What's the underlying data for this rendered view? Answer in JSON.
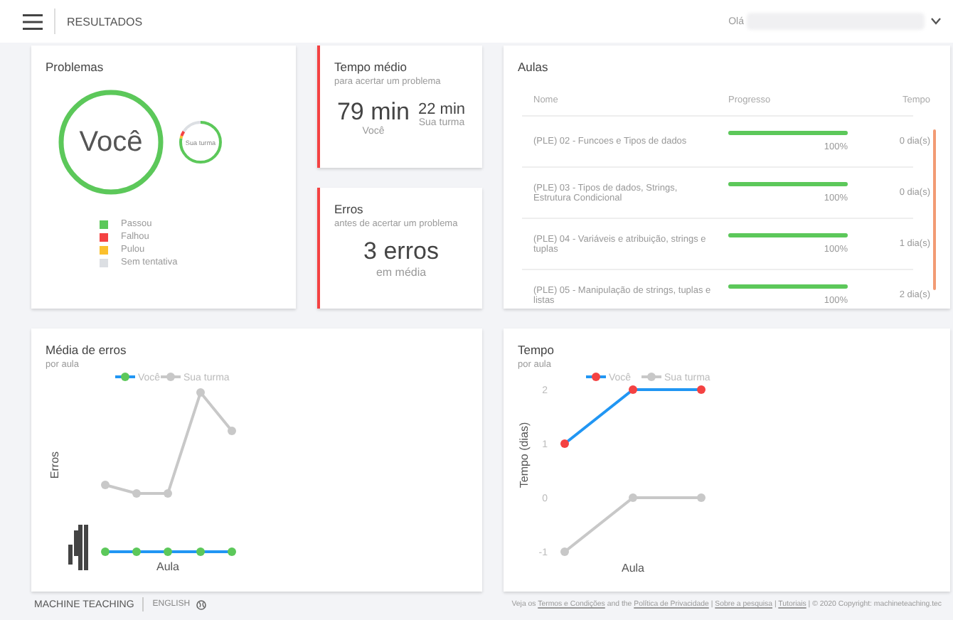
{
  "header": {
    "title": "RESULTADOS",
    "greeting": "Olá"
  },
  "problemas": {
    "title": "Problemas",
    "you_label": "Você",
    "class_label": "Sua turma",
    "legend": [
      {
        "label": "Passou",
        "color": "#5cc85a"
      },
      {
        "label": "Falhou",
        "color": "#f44242"
      },
      {
        "label": "Pulou",
        "color": "#fbc02d"
      },
      {
        "label": "Sem tentativa",
        "color": "#dcdfe3"
      }
    ]
  },
  "tempo_medio": {
    "title": "Tempo médio",
    "subtitle": "para acertar um problema",
    "you_value": "79 min",
    "you_label": "Você",
    "class_value": "22 min",
    "class_label": "Sua turma"
  },
  "erros": {
    "title": "Erros",
    "subtitle": "antes de acertar um problema",
    "value": "3 erros",
    "caption": "em média"
  },
  "aulas": {
    "title": "Aulas",
    "columns": [
      "Nome",
      "Progresso",
      "Tempo"
    ],
    "rows": [
      {
        "name": "(PLE) 02 - Funcoes e Tipos de dados",
        "level": 1,
        "progress": "100%",
        "time": "0 dia(s)"
      },
      {
        "name": "(PLE) 03 - Tipos de dados, Strings, Estrutura Condicional",
        "level": 1,
        "progress": "100%",
        "time": "0 dia(s)"
      },
      {
        "name": "(PLE) 04 - Variáveis e atribuição, strings e tuplas",
        "level": 1,
        "progress": "100%",
        "time": "1 dia(s)"
      },
      {
        "name": "(PLE) 05 - Manipulação de strings, tuplas e listas",
        "level": 1,
        "progress": "100%",
        "time": "2 dia(s)"
      }
    ]
  },
  "media_erros": {
    "title": "Média de erros",
    "subtitle": "por aula",
    "legend": [
      "Você",
      "Sua turma"
    ],
    "ylabel": "Erros",
    "xlabel": "Aula"
  },
  "tempo": {
    "title": "Tempo",
    "subtitle": "por aula",
    "chart_data": {
      "type": "line",
      "xlabel": "Aula",
      "ylabel": "Tempo (dias)",
      "yticks": [
        -1,
        0,
        1,
        2
      ],
      "ylim": [
        -1,
        2
      ],
      "legend": true,
      "series": [
        {
          "name": "Você",
          "color": "#2196f3",
          "marker": "circle",
          "values": [
            1,
            2,
            2
          ]
        },
        {
          "name": "Sua turma",
          "color": "#c8c8c8",
          "marker": "circle",
          "values": [
            -1,
            0,
            0
          ]
        }
      ]
    }
  },
  "footer": {
    "brand": "MACHINE TEACHING",
    "language": "ENGLISH",
    "legal": [
      {
        "kind": "text",
        "text": "Veja os "
      },
      {
        "kind": "link",
        "text": "Termos e Condições"
      },
      {
        "kind": "text",
        "text": " and the "
      },
      {
        "kind": "link",
        "text": "Política de Privacidade"
      },
      {
        "kind": "text",
        "text": " | "
      },
      {
        "kind": "link",
        "text": "Sobre a pesquisa"
      },
      {
        "kind": "text",
        "text": " | "
      },
      {
        "kind": "link",
        "text": "Tutoriais"
      },
      {
        "kind": "text",
        "text": " | © 2020 Copyright: machineteaching.tec"
      }
    ]
  }
}
